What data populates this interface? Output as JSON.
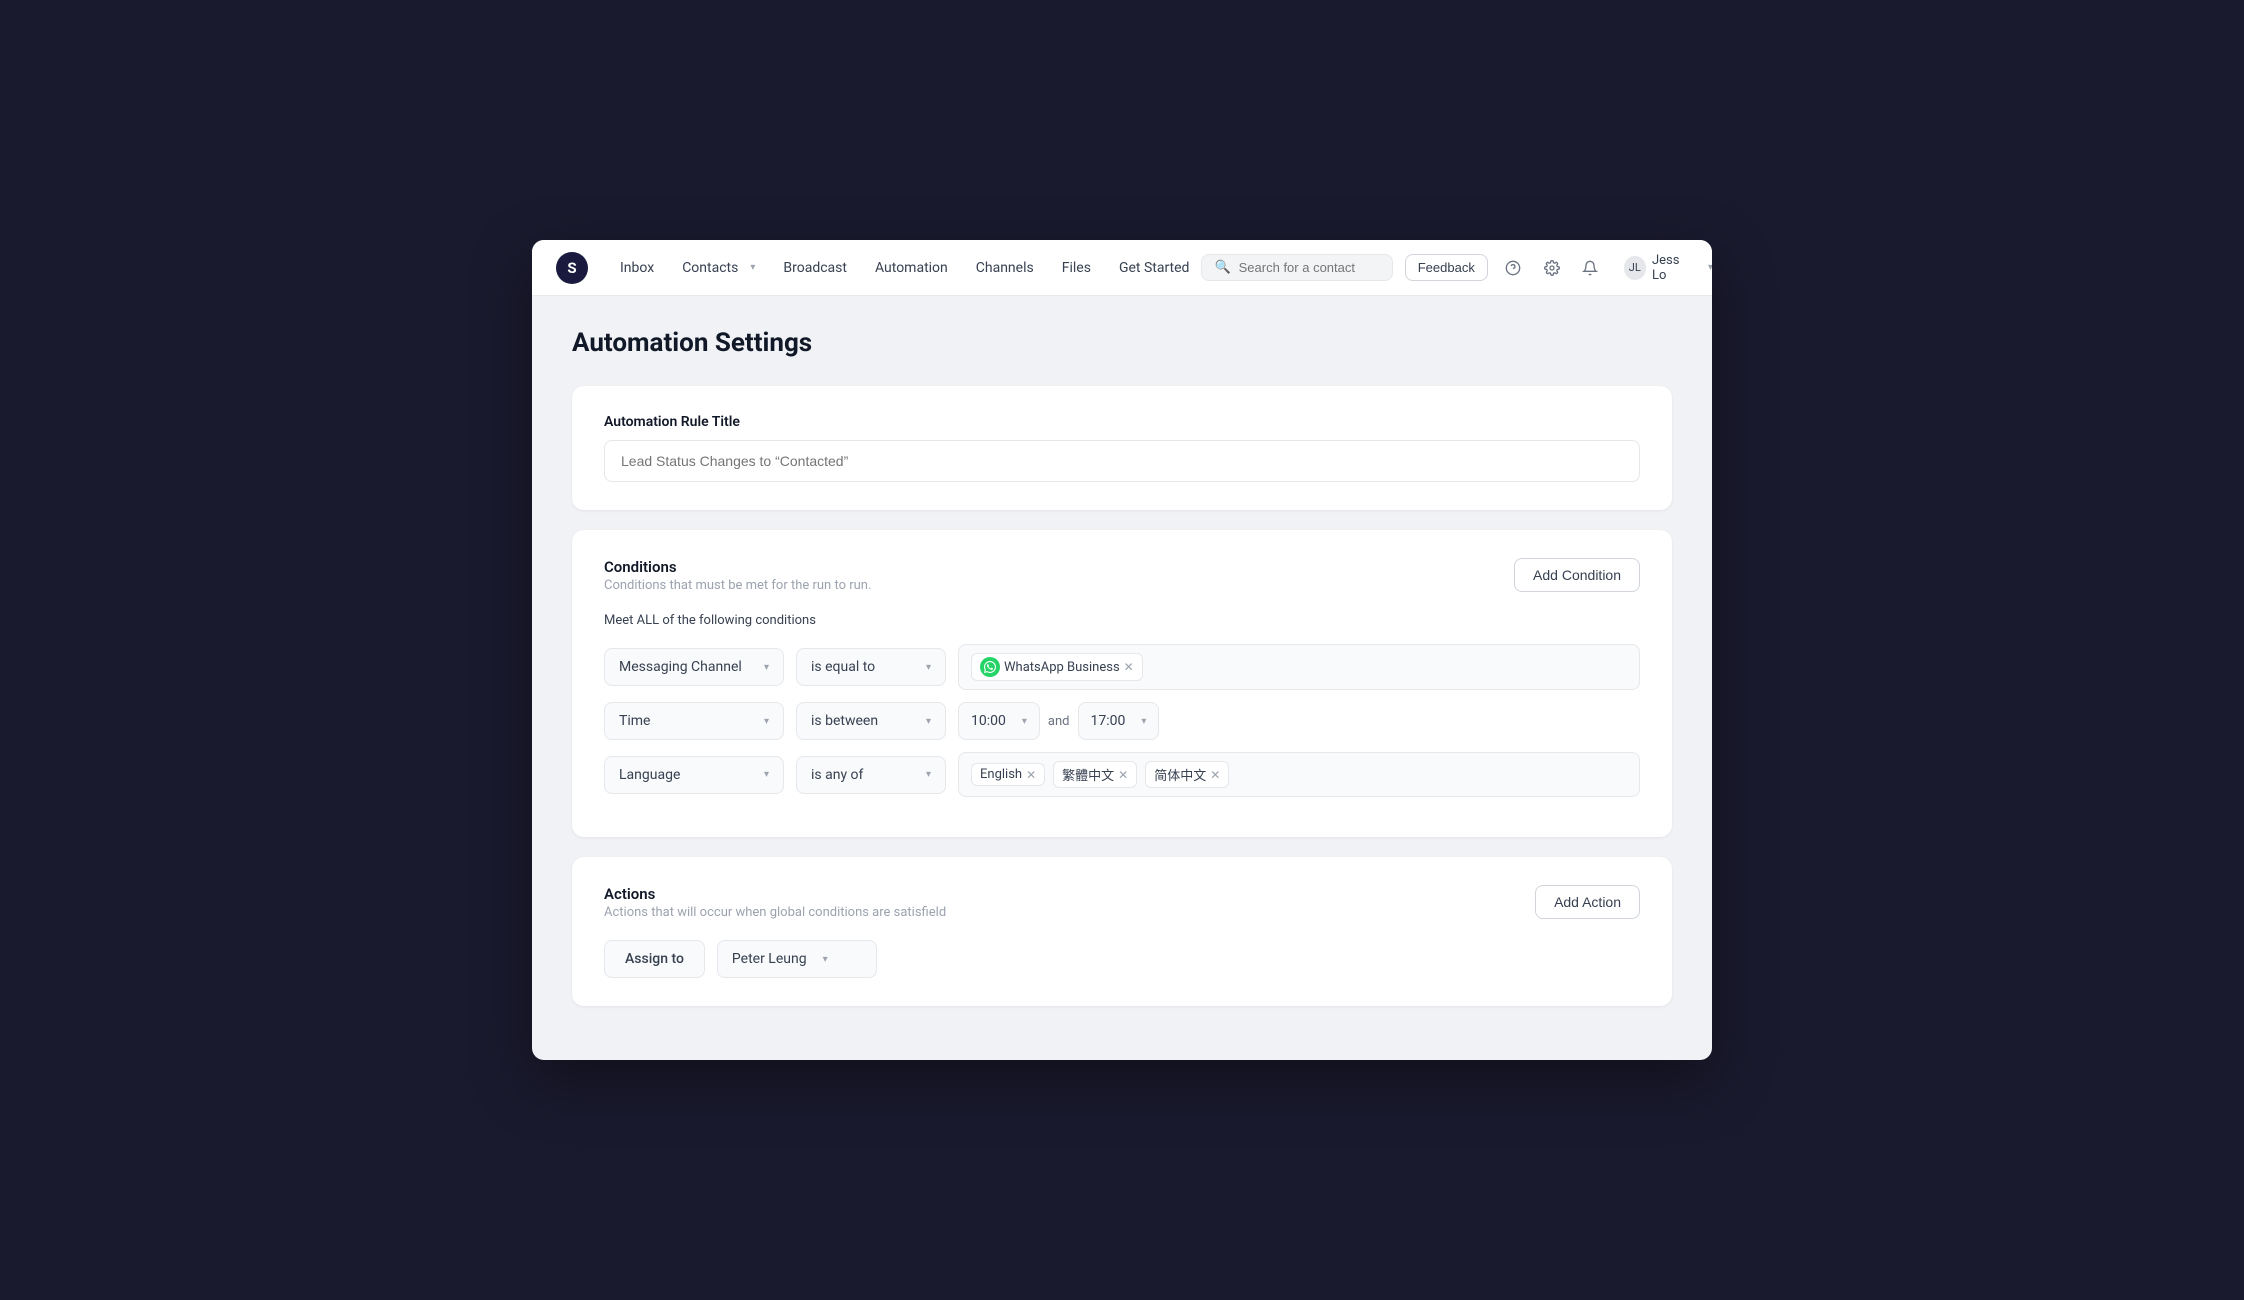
{
  "nav": {
    "logo": "S",
    "items": [
      {
        "id": "inbox",
        "label": "Inbox",
        "hasChevron": false
      },
      {
        "id": "contacts",
        "label": "Contacts",
        "hasChevron": true
      },
      {
        "id": "broadcast",
        "label": "Broadcast",
        "hasChevron": false
      },
      {
        "id": "automation",
        "label": "Automation",
        "hasChevron": false
      },
      {
        "id": "channels",
        "label": "Channels",
        "hasChevron": false
      },
      {
        "id": "files",
        "label": "Files",
        "hasChevron": false
      },
      {
        "id": "get-started",
        "label": "Get Started",
        "hasChevron": false
      }
    ],
    "search_placeholder": "Search for a contact",
    "feedback_label": "Feedback",
    "user_name": "Jess Lo"
  },
  "page": {
    "title": "Automation Settings"
  },
  "rule": {
    "title_label": "Automation Rule Title",
    "title_placeholder": "Lead Status Changes to “Contacted”"
  },
  "conditions": {
    "section_title": "Conditions",
    "section_subtitle": "Conditions that must be met for the run to run.",
    "meet_all_label": "Meet ALL of the following conditions",
    "add_button": "Add Condition",
    "rows": [
      {
        "field": "Messaging Channel",
        "operator": "is equal to",
        "value_type": "tag_with_icon",
        "values": [
          {
            "label": "WhatsApp Business",
            "icon": "whatsapp"
          }
        ]
      },
      {
        "field": "Time",
        "operator": "is between",
        "value_type": "time_range",
        "time_from": "10:00",
        "time_and": "and",
        "time_to": "17:00"
      },
      {
        "field": "Language",
        "operator": "is any of",
        "value_type": "tags",
        "values": [
          {
            "label": "English"
          },
          {
            "label": "繁體中文"
          },
          {
            "label": "简体中文"
          }
        ]
      }
    ]
  },
  "actions": {
    "section_title": "Actions",
    "section_subtitle": "Actions that will occur when global conditions are satisfield",
    "add_button": "Add Action",
    "rows": [
      {
        "label": "Assign to",
        "value": "Peter Leung"
      }
    ]
  }
}
